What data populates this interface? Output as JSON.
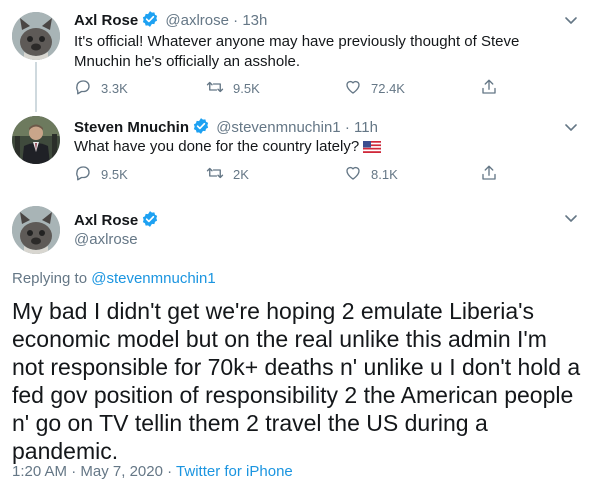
{
  "tweets": [
    {
      "name": "Axl Rose",
      "handle": "@axlrose",
      "separator": "·",
      "time": "13h",
      "text": "It's official! Whatever anyone may have previously thought of Steve Mnuchin he's officially an asshole.",
      "replies": "3.3K",
      "retweets": "9.5K",
      "likes": "72.4K"
    },
    {
      "name": "Steven Mnuchin",
      "handle": "@stevenmnuchin1",
      "separator": "·",
      "time": "11h",
      "text": "What have you done for the country lately?",
      "replies": "9.5K",
      "retweets": "2K",
      "likes": "8.1K"
    }
  ],
  "main_tweet": {
    "name": "Axl Rose",
    "handle": "@axlrose",
    "replying_prefix": "Replying to",
    "replying_handle": "@stevenmnuchin1",
    "text": "My bad I didn't get we're hoping 2 emulate Liberia's economic model but on the real unlike this admin I'm not responsible for 70k+ deaths n' unlike u I don't hold a fed gov position of responsibility 2 the American people n' go on TV tellin them 2 travel the US during a pandemic.",
    "time": "1:20 AM",
    "separator": "·",
    "date": "May 7, 2020",
    "source": "Twitter for iPhone"
  },
  "colors": {
    "verified": "#1da1f2",
    "link": "#1b95e0",
    "muted": "#657786",
    "text": "#14171a",
    "thread_line": "#cfd9de"
  },
  "icons": [
    "verified-badge-icon",
    "chevron-down-icon",
    "reply-icon",
    "retweet-icon",
    "like-icon",
    "share-icon",
    "us-flag-icon"
  ]
}
